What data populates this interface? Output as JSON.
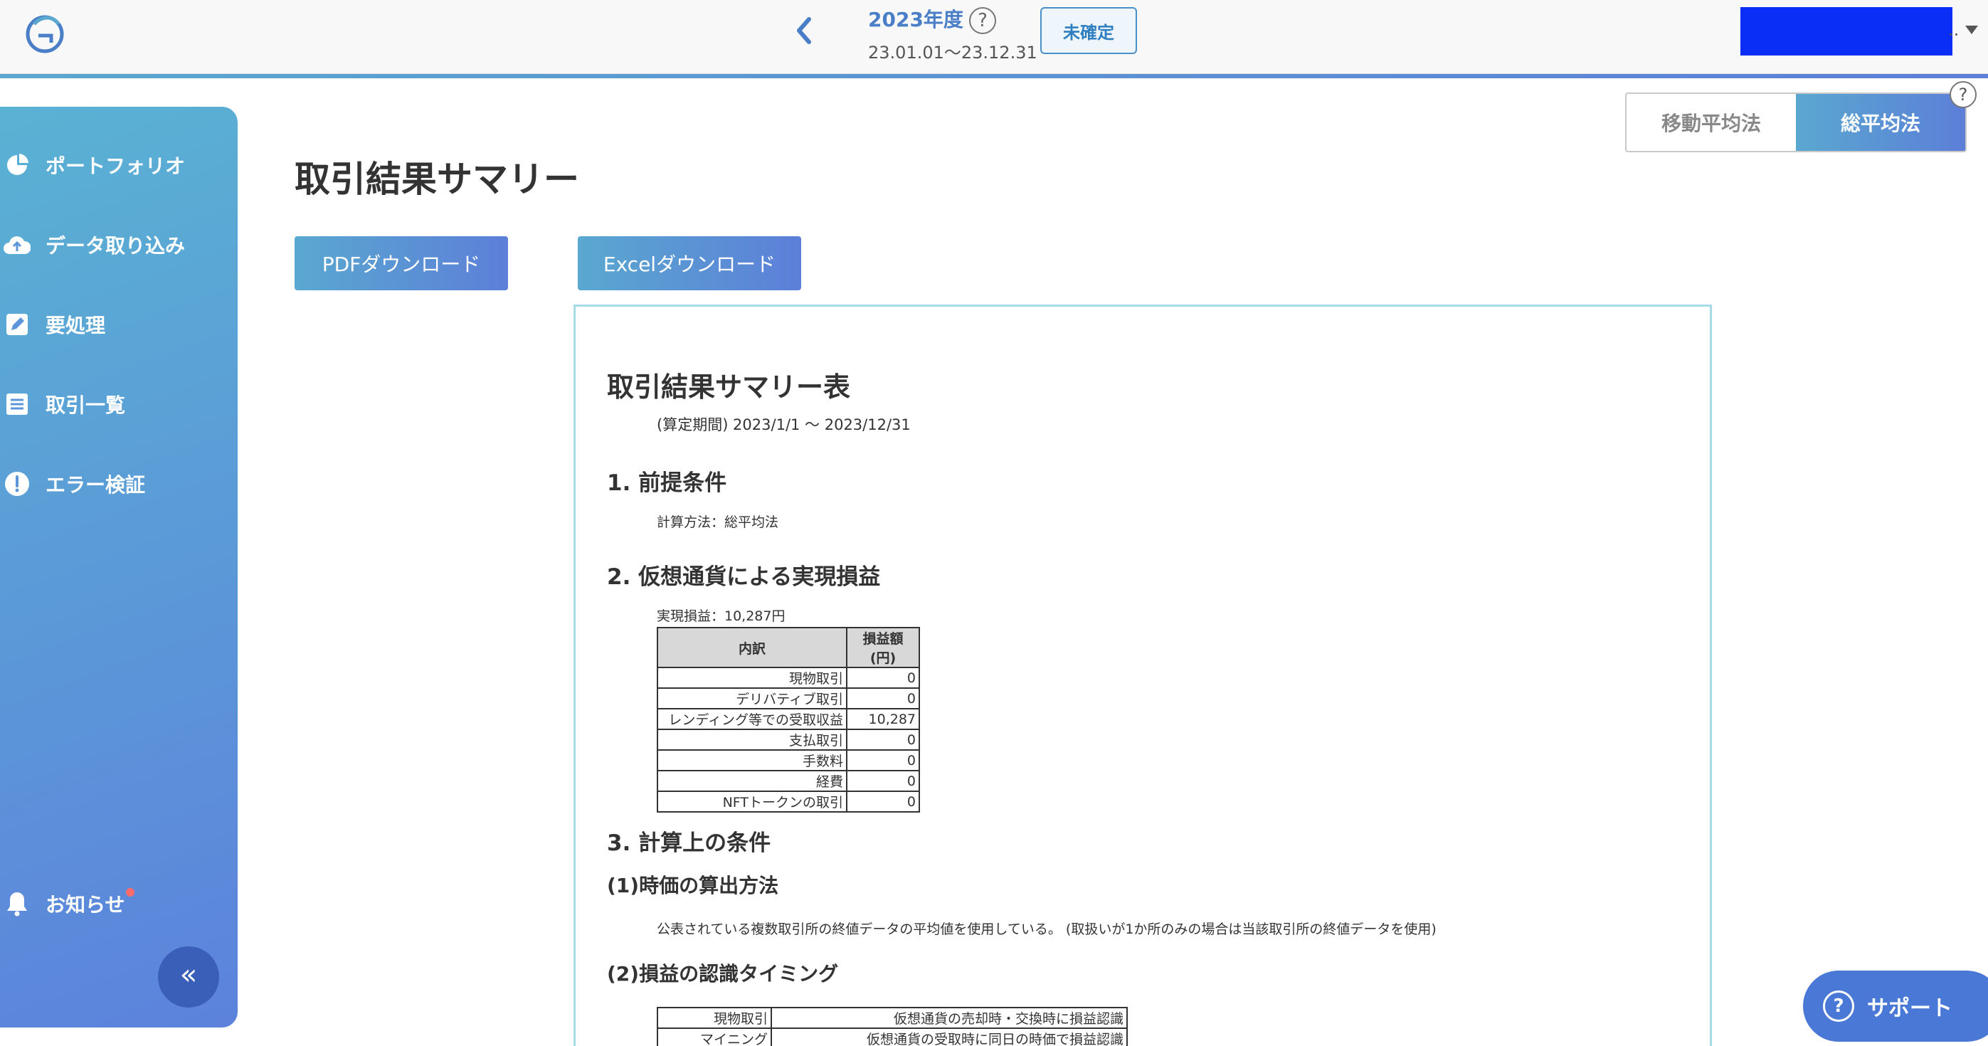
{
  "header": {
    "year_label": "2023年度",
    "help_glyph": "?",
    "year_range": "23.01.01〜23.12.31",
    "status_button": "未確定",
    "user_ellipsis": "..",
    "icons": [
      "logo-icon",
      "chevron-left-icon",
      "help-icon",
      "caret-down-icon"
    ]
  },
  "sidebar": {
    "items": [
      {
        "label": "ポートフォリオ",
        "icon": "pie-chart-icon"
      },
      {
        "label": "データ取り込み",
        "icon": "cloud-upload-icon"
      },
      {
        "label": "要処理",
        "icon": "edit-icon"
      },
      {
        "label": "取引一覧",
        "icon": "list-icon"
      },
      {
        "label": "エラー検証",
        "icon": "alert-icon"
      }
    ],
    "notification": {
      "label": "お知らせ",
      "icon": "bell-icon"
    },
    "collapse_glyph": "«"
  },
  "method_toggle": {
    "options": [
      "移動平均法",
      "総平均法"
    ],
    "selected": "総平均法"
  },
  "page": {
    "title": "取引結果サマリー",
    "pdf_button": "PDFダウンロード",
    "excel_button": "Excelダウンロード"
  },
  "report": {
    "title": "取引結果サマリー表",
    "period": "(算定期間) 2023/1/1 〜 2023/12/31",
    "section1_heading": "1. 前提条件",
    "section1_text": "計算方法：総平均法",
    "section2_heading": "2. 仮想通貨による実現損益",
    "realized_text": "実現損益：10,287円",
    "breakdown_headers": [
      "内訳",
      "損益額(円)"
    ],
    "breakdown_rows": [
      {
        "label": "現物取引",
        "value": "0"
      },
      {
        "label": "デリバティブ取引",
        "value": "0"
      },
      {
        "label": "レンディング等での受取収益",
        "value": "10,287"
      },
      {
        "label": "支払取引",
        "value": "0"
      },
      {
        "label": "手数料",
        "value": "0"
      },
      {
        "label": "経費",
        "value": "0"
      },
      {
        "label": "NFTトークンの取引",
        "value": "0"
      }
    ],
    "section3_heading": "3. 計算上の条件",
    "sub1_heading": "(1)時価の算出方法",
    "sub1_text": "公表されている複数取引所の終値データの平均値を使用している。 (取扱いが1か所のみの場合は当該取引所の終値データを使用)",
    "sub2_heading": "(2)損益の認識タイミング",
    "timing_rows": [
      {
        "label": "現物取引",
        "value": "仮想通貨の売却時・交換時に損益認識"
      },
      {
        "label": "マイニング",
        "value": "仮想通貨の受取時に同日の時価で損益認識"
      }
    ]
  },
  "support": {
    "label": "サポート",
    "icon_glyph": "?"
  },
  "colors": {
    "accent": "#4a7fc8",
    "sidebar_gradient_start": "#5ab2d3",
    "sidebar_gradient_end": "#5c82dc",
    "user_box": "#0a2ef5",
    "notification_dot": "#ff6b6b",
    "report_border": "#a8dbe8"
  }
}
